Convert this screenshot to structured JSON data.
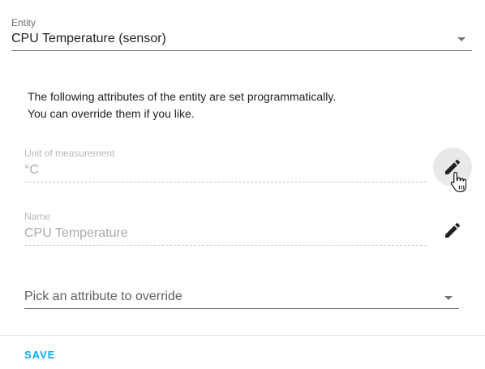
{
  "entity": {
    "label": "Entity",
    "value": "CPU Temperature (sensor)"
  },
  "info": {
    "line1": "The following attributes of the entity are set programmatically.",
    "line2": "You can override them if you like."
  },
  "attributes": [
    {
      "label": "Unit of measurement",
      "value": "°C",
      "state": "hovered"
    },
    {
      "label": "Name",
      "value": "CPU Temperature",
      "state": "normal"
    }
  ],
  "pick_attribute": {
    "placeholder": "Pick an attribute to override"
  },
  "footer": {
    "save_label": "SAVE"
  },
  "colors": {
    "accent": "#03a9f4",
    "text": "#212121",
    "disabled_text": "#a9a9a9"
  },
  "icons": {
    "edit": "pencil-icon",
    "dropdown": "triangle-down-icon",
    "cursor": "hand-pointer-cursor"
  }
}
